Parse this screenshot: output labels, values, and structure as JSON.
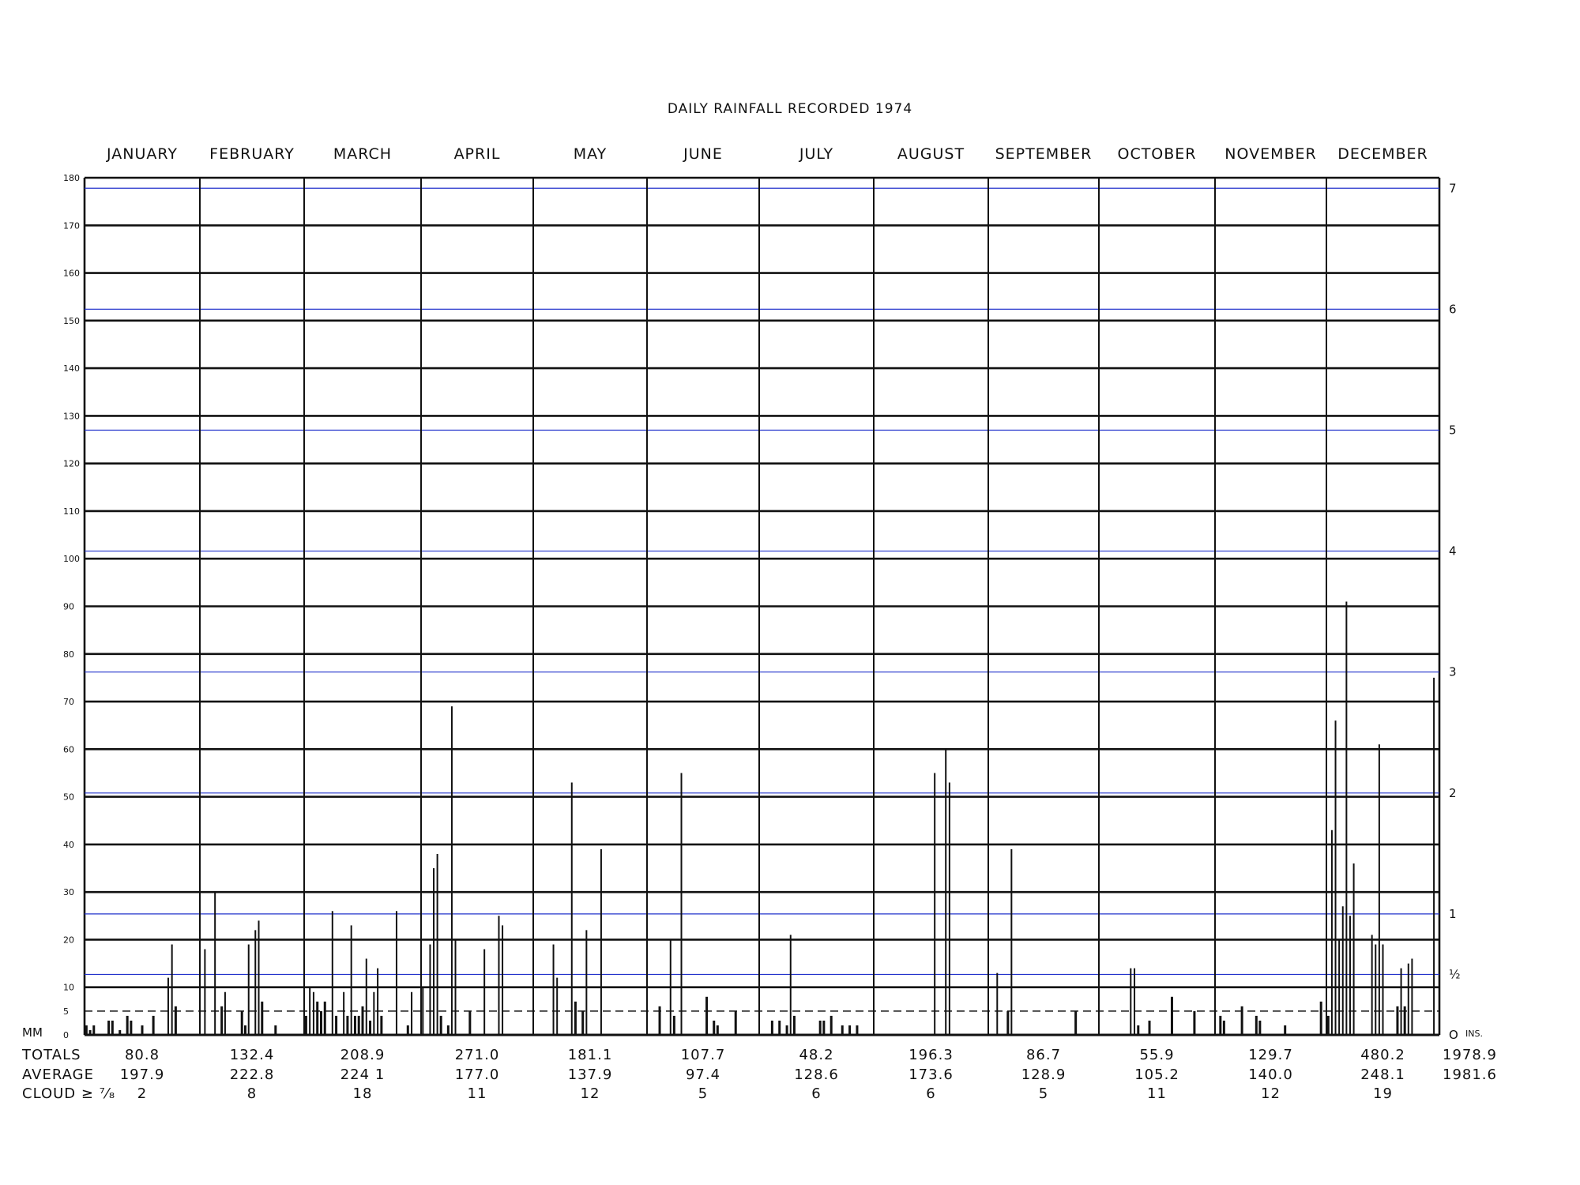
{
  "chart_data": {
    "type": "bar",
    "title": "DAILY RAINFALL RECORDED 1974",
    "ylabel_left": "MM",
    "ylabel_right": "INS.",
    "ylim": [
      0,
      180
    ],
    "left_ticks": [
      0,
      5,
      10,
      20,
      30,
      40,
      50,
      60,
      70,
      80,
      90,
      100,
      110,
      120,
      130,
      140,
      150,
      160,
      170,
      180
    ],
    "right_ticks": [
      {
        "label": "O",
        "inches": 0
      },
      {
        "label": "½",
        "inches": 0.5
      },
      {
        "label": "1",
        "inches": 1
      },
      {
        "label": "2",
        "inches": 2
      },
      {
        "label": "3",
        "inches": 3
      },
      {
        "label": "4",
        "inches": 4
      },
      {
        "label": "5",
        "inches": 5
      },
      {
        "label": "6",
        "inches": 6
      },
      {
        "label": "7",
        "inches": 7
      }
    ],
    "months": [
      "JANUARY",
      "FEBRUARY",
      "MARCH",
      "APRIL",
      "MAY",
      "JUNE",
      "JULY",
      "AUGUST",
      "SEPTEMBER",
      "OCTOBER",
      "NOVEMBER",
      "DECEMBER"
    ],
    "series": [
      {
        "month": "JANUARY",
        "values": [
          [
            1,
            2
          ],
          [
            2,
            1
          ],
          [
            3,
            2
          ],
          [
            7,
            3
          ],
          [
            8,
            3
          ],
          [
            10,
            1
          ],
          [
            12,
            4
          ],
          [
            13,
            3
          ],
          [
            16,
            2
          ],
          [
            19,
            4
          ],
          [
            23,
            12
          ],
          [
            24,
            19
          ],
          [
            25,
            6
          ]
        ]
      },
      {
        "month": "FEBRUARY",
        "values": [
          [
            2,
            18
          ],
          [
            5,
            30
          ],
          [
            7,
            6
          ],
          [
            8,
            9
          ],
          [
            13,
            5
          ],
          [
            14,
            2
          ],
          [
            15,
            19
          ],
          [
            17,
            22
          ],
          [
            18,
            24
          ],
          [
            19,
            7
          ],
          [
            23,
            2
          ]
        ]
      },
      {
        "month": "MARCH",
        "values": [
          [
            1,
            4
          ],
          [
            2,
            10
          ],
          [
            3,
            9
          ],
          [
            4,
            7
          ],
          [
            5,
            5
          ],
          [
            6,
            7
          ],
          [
            8,
            26
          ],
          [
            9,
            4
          ],
          [
            11,
            9
          ],
          [
            12,
            4
          ],
          [
            13,
            23
          ],
          [
            14,
            4
          ],
          [
            15,
            4
          ],
          [
            16,
            6
          ],
          [
            17,
            16
          ],
          [
            18,
            3
          ],
          [
            19,
            9
          ],
          [
            20,
            14
          ],
          [
            21,
            4
          ],
          [
            25,
            26
          ],
          [
            28,
            2
          ],
          [
            29,
            9
          ]
        ]
      },
      {
        "month": "APRIL",
        "values": [
          [
            1,
            10
          ],
          [
            3,
            19
          ],
          [
            4,
            35
          ],
          [
            5,
            38
          ],
          [
            6,
            4
          ],
          [
            8,
            2
          ],
          [
            9,
            69
          ],
          [
            10,
            20
          ],
          [
            14,
            5
          ],
          [
            18,
            18
          ],
          [
            22,
            25
          ],
          [
            23,
            23
          ]
        ]
      },
      {
        "month": "MAY",
        "values": [
          [
            6,
            19
          ],
          [
            7,
            12
          ],
          [
            11,
            53
          ],
          [
            12,
            7
          ],
          [
            14,
            5
          ],
          [
            15,
            22
          ],
          [
            19,
            39
          ]
        ]
      },
      {
        "month": "JUNE",
        "values": [
          [
            4,
            6
          ],
          [
            7,
            20
          ],
          [
            8,
            4
          ],
          [
            10,
            55
          ],
          [
            17,
            8
          ],
          [
            19,
            3
          ],
          [
            20,
            2
          ],
          [
            25,
            5
          ]
        ]
      },
      {
        "month": "JULY",
        "values": [
          [
            4,
            3
          ],
          [
            6,
            3
          ],
          [
            8,
            2
          ],
          [
            9,
            21
          ],
          [
            10,
            4
          ],
          [
            17,
            3
          ],
          [
            18,
            3
          ],
          [
            20,
            4
          ],
          [
            23,
            2
          ],
          [
            25,
            2
          ],
          [
            27,
            2
          ]
        ]
      },
      {
        "month": "AUGUST",
        "values": [
          [
            17,
            55
          ],
          [
            20,
            60
          ],
          [
            21,
            53
          ]
        ]
      },
      {
        "month": "SEPTEMBER",
        "values": [
          [
            3,
            13
          ],
          [
            6,
            5
          ],
          [
            7,
            39
          ],
          [
            25,
            5
          ]
        ]
      },
      {
        "month": "OCTOBER",
        "values": [
          [
            9,
            14
          ],
          [
            10,
            14
          ],
          [
            11,
            2
          ],
          [
            14,
            3
          ],
          [
            20,
            8
          ],
          [
            26,
            5
          ]
        ]
      },
      {
        "month": "NOVEMBER",
        "values": [
          [
            2,
            4
          ],
          [
            3,
            3
          ],
          [
            8,
            6
          ],
          [
            12,
            4
          ],
          [
            13,
            3
          ],
          [
            20,
            2
          ],
          [
            30,
            7
          ]
        ]
      },
      {
        "month": "DECEMBER",
        "values": [
          [
            1,
            4
          ],
          [
            2,
            43
          ],
          [
            3,
            66
          ],
          [
            4,
            20
          ],
          [
            5,
            27
          ],
          [
            6,
            91
          ],
          [
            7,
            25
          ],
          [
            8,
            36
          ],
          [
            13,
            21
          ],
          [
            14,
            19
          ],
          [
            15,
            61
          ],
          [
            16,
            19
          ],
          [
            20,
            6
          ],
          [
            21,
            14
          ],
          [
            22,
            6
          ],
          [
            23,
            15
          ],
          [
            24,
            16
          ],
          [
            30,
            75
          ]
        ]
      }
    ]
  },
  "table": {
    "labels": {
      "totals": "TOTALS",
      "average": "AVERAGE",
      "cloud": "CLOUD ≥ ⁷⁄₈"
    },
    "totals": [
      "80.8",
      "132.4",
      "208.9",
      "271.0",
      "181.1",
      "107.7",
      "48.2",
      "196.3",
      "86.7",
      "55.9",
      "129.7",
      "480.2",
      "1978.9"
    ],
    "average": [
      "197.9",
      "222.8",
      "224 1",
      "177.0",
      "137.9",
      "97.4",
      "128.6",
      "173.6",
      "128.9",
      "105.2",
      "140.0",
      "248.1",
      "1981.6"
    ],
    "cloud": [
      "2",
      "8",
      "18",
      "11",
      "12",
      "5",
      "6",
      "6",
      "5",
      "11",
      "12",
      "19",
      ""
    ]
  },
  "colors": {
    "ink": "#111111",
    "blue_rule": "#2233cc"
  }
}
